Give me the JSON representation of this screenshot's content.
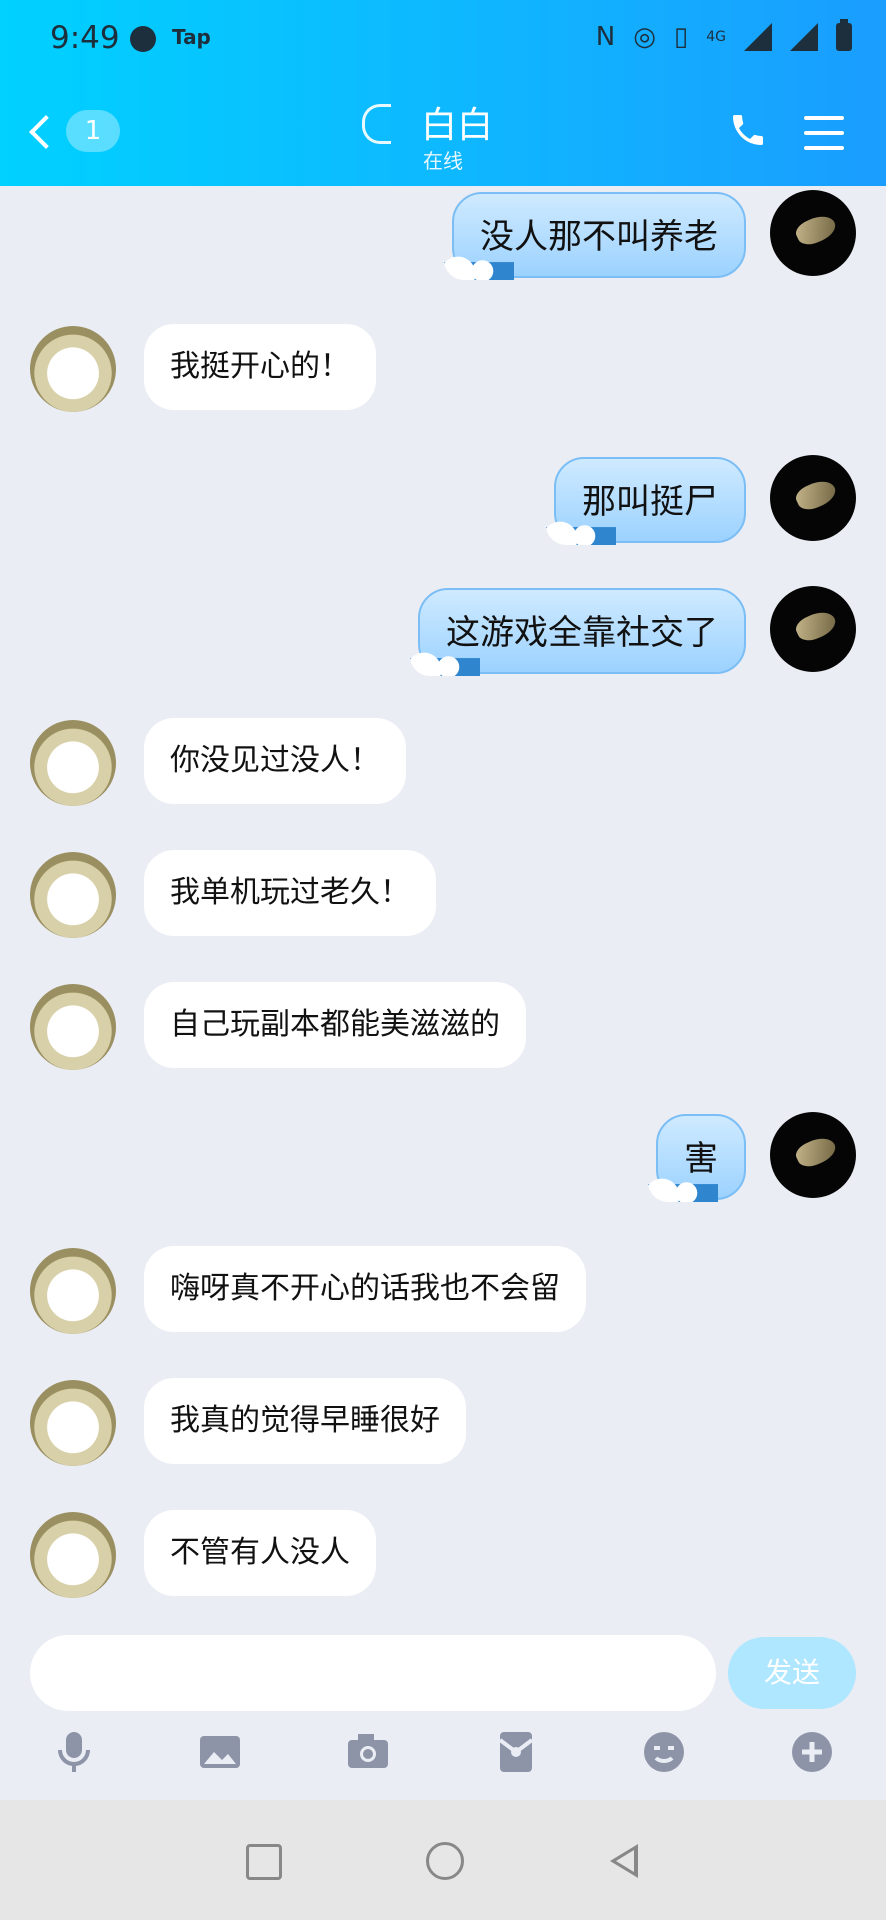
{
  "status_bar": {
    "time": "9:49",
    "app_label": "Tap",
    "network": "4G"
  },
  "header": {
    "back_badge": "1",
    "title": "白白",
    "status": "在线"
  },
  "messages": [
    {
      "sender": "me",
      "text": "没人那不叫养老"
    },
    {
      "sender": "other",
      "text": "我挺开心的！"
    },
    {
      "sender": "me",
      "text": "那叫挺尸"
    },
    {
      "sender": "me",
      "text": "这游戏全靠社交了"
    },
    {
      "sender": "other",
      "text": "你没见过没人！"
    },
    {
      "sender": "other",
      "text": "我单机玩过老久！"
    },
    {
      "sender": "other",
      "text": "自己玩副本都能美滋滋的"
    },
    {
      "sender": "me",
      "text": "害"
    },
    {
      "sender": "other",
      "text": "嗨呀真不开心的话我也不会留"
    },
    {
      "sender": "other",
      "text": "我真的觉得早睡很好"
    },
    {
      "sender": "other",
      "text": "不管有人没人"
    }
  ],
  "composer": {
    "input_value": "",
    "send_label": "发送"
  },
  "toolbar_icons": [
    "microphone-icon",
    "image-icon",
    "camera-icon",
    "red-packet-icon",
    "emoji-icon",
    "plus-icon"
  ],
  "colors": {
    "header_start": "#00d1ff",
    "header_end": "#1a9dff",
    "background": "#eaedf4",
    "my_bubble": "#a9d8ff"
  }
}
